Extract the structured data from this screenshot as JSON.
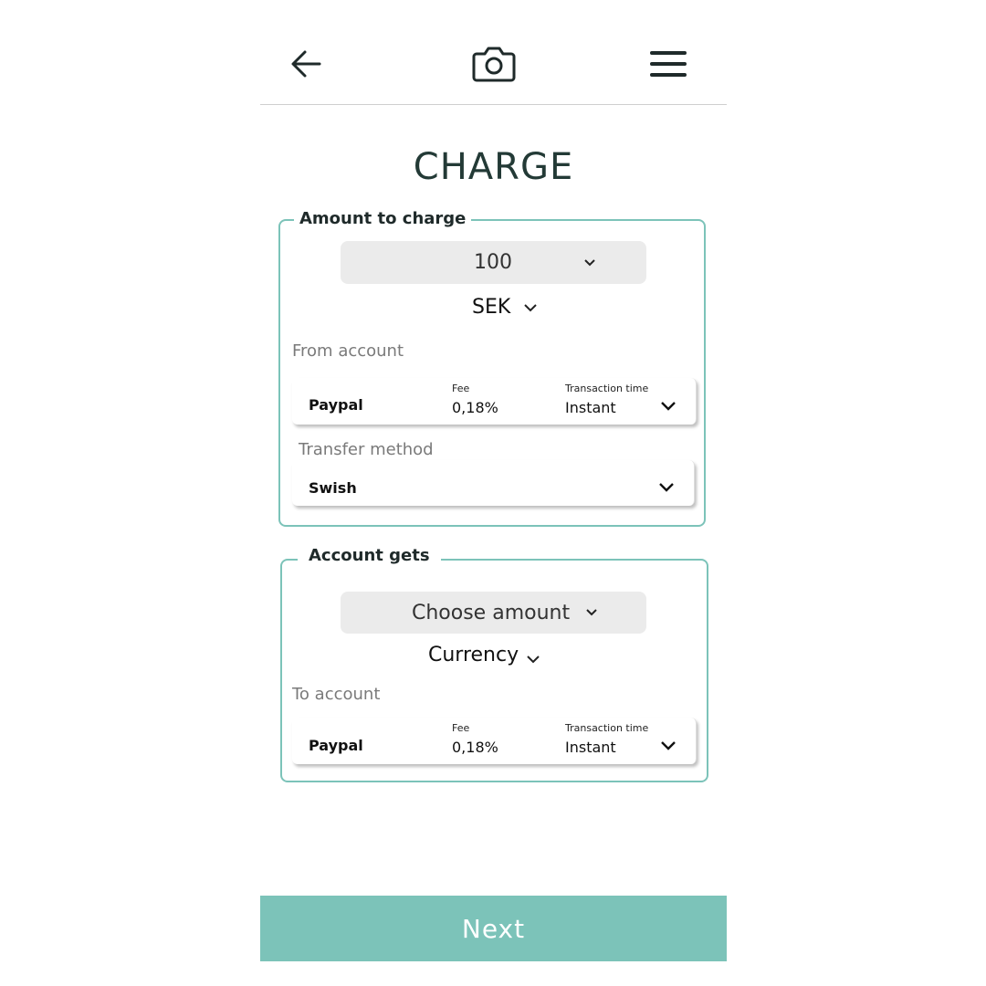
{
  "header": {
    "back_icon": "arrow-left-icon",
    "camera_icon": "camera-icon",
    "menu_icon": "hamburger-menu-icon"
  },
  "page_title": "CHARGE",
  "amount_section": {
    "legend": "Amount to charge",
    "amount_value": "100",
    "currency_value": "SEK",
    "from_account_label": "From account",
    "from_account": {
      "name": "Paypal",
      "fee_label": "Fee",
      "fee_value": "0,18%",
      "time_label": "Transaction time",
      "time_value": "Instant"
    },
    "transfer_method_label": "Transfer method",
    "transfer_method_value": "Swish"
  },
  "gets_section": {
    "legend": "Account gets",
    "amount_placeholder": "Choose amount",
    "currency_placeholder": "Currency",
    "to_account_label": "To account",
    "to_account": {
      "name": "Paypal",
      "fee_label": "Fee",
      "fee_value": "0,18%",
      "time_label": "Transaction time",
      "time_value": "Instant"
    }
  },
  "next_button_label": "Next",
  "colors": {
    "accent": "#7cc3b9",
    "select_bg": "#ebebeb",
    "title": "#233a36"
  }
}
